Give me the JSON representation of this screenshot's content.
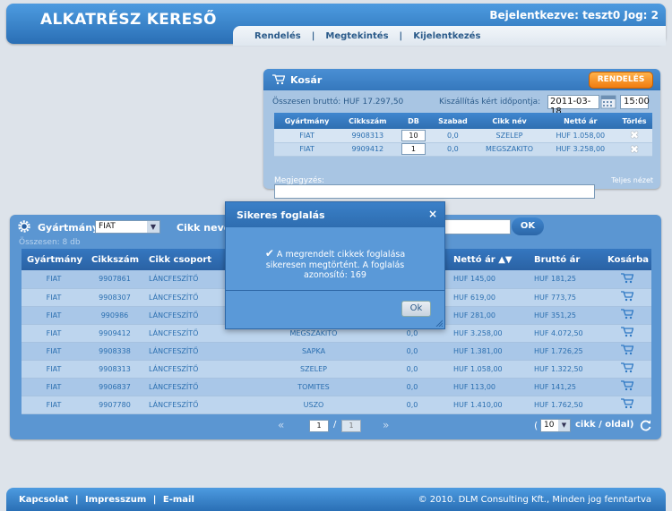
{
  "header": {
    "brand": "ALKATRÉSZ KERESŐ",
    "user_info": "Bejelentkezve: teszt0 Jog: 2",
    "nav": [
      "Rendelés",
      "Megtekintés",
      "Kijelentkezés"
    ],
    "nav_sep": "|"
  },
  "cart": {
    "title": "Kosár",
    "order_button": "RENDELÉS",
    "gross_total": "Összesen bruttó: HUF 17.297,50",
    "ship_label": "Kiszállítás kért időpontja:",
    "ship_date": "2011-03-18",
    "ship_time": "15:00",
    "columns": [
      "Gyártmány",
      "Cikkszám",
      "DB",
      "Szabad",
      "Cikk név",
      "Nettó ár",
      "Törlés"
    ],
    "rows": [
      {
        "make": "FIAT",
        "code": "9908313",
        "qty": "10",
        "free": "0,0",
        "name": "SZELEP",
        "net": "HUF 1.058,00"
      },
      {
        "make": "FIAT",
        "code": "9909412",
        "qty": "1",
        "free": "0,0",
        "name": "MEGSZAKITO",
        "net": "HUF 3.258,00"
      }
    ],
    "notes_label": "Megjegyzés:",
    "full_view": "Teljes nézet"
  },
  "search": {
    "manufacturer_label": "Gyártmány:",
    "manufacturer_value": "FIAT",
    "item_name_label": "Cikk neve:",
    "ok_label": "OK",
    "total_count": "Összesen: 8 db"
  },
  "products": {
    "columns": [
      "Gyártmány",
      "Cikkszám",
      "Cikk csoport",
      "",
      "",
      "Nettó ár ▲▼",
      "Bruttó ár",
      "Kosárba"
    ],
    "rows": [
      {
        "make": "FIAT",
        "code": "9907861",
        "group": "LÁNCFESZÍTŐ",
        "name": "",
        "free": "",
        "net": "HUF 145,00",
        "gross": "HUF 181,25"
      },
      {
        "make": "FIAT",
        "code": "9908307",
        "group": "LÁNCFESZÍTŐ",
        "name": "",
        "free": "",
        "net": "HUF 619,00",
        "gross": "HUF 773,75"
      },
      {
        "make": "FIAT",
        "code": "990986",
        "group": "LÁNCFESZÍTŐ",
        "name": "",
        "free": "",
        "net": "HUF 281,00",
        "gross": "HUF 351,25"
      },
      {
        "make": "FIAT",
        "code": "9909412",
        "group": "LÁNCFESZÍTŐ",
        "name": "MEGSZAKITO",
        "free": "0,0",
        "net": "HUF 3.258,00",
        "gross": "HUF 4.072,50"
      },
      {
        "make": "FIAT",
        "code": "9908338",
        "group": "LÁNCFESZÍTŐ",
        "name": "SAPKA",
        "free": "0,0",
        "net": "HUF 1.381,00",
        "gross": "HUF 1.726,25"
      },
      {
        "make": "FIAT",
        "code": "9908313",
        "group": "LÁNCFESZÍTŐ",
        "name": "SZELEP",
        "free": "0,0",
        "net": "HUF 1.058,00",
        "gross": "HUF 1.322,50"
      },
      {
        "make": "FIAT",
        "code": "9906837",
        "group": "LÁNCFESZÍTŐ",
        "name": "TOMITES",
        "free": "0,0",
        "net": "HUF 113,00",
        "gross": "HUF 141,25"
      },
      {
        "make": "FIAT",
        "code": "9907780",
        "group": "LÁNCFESZÍTŐ",
        "name": "USZO",
        "free": "0,0",
        "net": "HUF 1.410,00",
        "gross": "HUF 1.762,50"
      }
    ]
  },
  "pager": {
    "prev": "«",
    "current": "1",
    "slash": "/",
    "total": "1",
    "next": "»",
    "paren": "(",
    "per_page": "10",
    "per_page_label": "cikk / oldal)"
  },
  "modal": {
    "title": "Sikeres foglalás",
    "close": "×",
    "message": "A megrendelt cikkek foglalása sikeresen megtörtént. A foglalás azonosító: 169",
    "ok": "Ok"
  },
  "footer": {
    "links": [
      "Kapcsolat",
      "Impresszum",
      "E-mail"
    ],
    "sep": "|",
    "copyright": "© 2010. DLM Consulting Kft., Minden jog fenntartva"
  },
  "colors": {
    "header_blue": "#2a6fb5",
    "order_orange": "#f07c10",
    "panel_blue": "#5b96d2",
    "text_blue": "#2b6fb0"
  }
}
